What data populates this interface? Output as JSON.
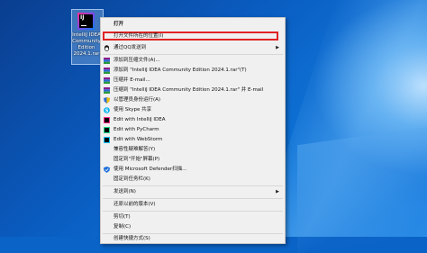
{
  "desktop": {
    "icon_label": "IntelliJ IDEA Community Edition 2024.1.rar",
    "logo_text": "IJ"
  },
  "context_menu": {
    "items": [
      {
        "label": "打开"
      },
      {
        "label": "打开文件所在的位置(I)"
      },
      {
        "label": "通过QQ发送到"
      },
      {
        "label": "添加到压缩文件(A)..."
      },
      {
        "label": "添加到 \"IntelliJ IDEA Community Edition 2024.1.rar\"(T)"
      },
      {
        "label": "压缩并 E-mail..."
      },
      {
        "label": "压缩到 \"IntelliJ IDEA Community Edition 2024.1.rar\" 并 E-mail"
      },
      {
        "label": "以管理员身份运行(A)"
      },
      {
        "label": "使用 Skype 共享"
      },
      {
        "label": "Edit with IntelliJ IDEA"
      },
      {
        "label": "Edit with PyCharm"
      },
      {
        "label": "Edit with WebStorm"
      },
      {
        "label": "兼容性疑难解答(Y)"
      },
      {
        "label": "固定到\"开始\"屏幕(P)"
      },
      {
        "label": "使用 Microsoft Defender扫描..."
      },
      {
        "label": "固定到任务栏(K)"
      },
      {
        "label": "发送到(N)"
      },
      {
        "label": "还原以前的版本(V)"
      },
      {
        "label": "剪切(T)"
      },
      {
        "label": "复制(C)"
      },
      {
        "label": "创建快捷方式(S)"
      }
    ]
  }
}
